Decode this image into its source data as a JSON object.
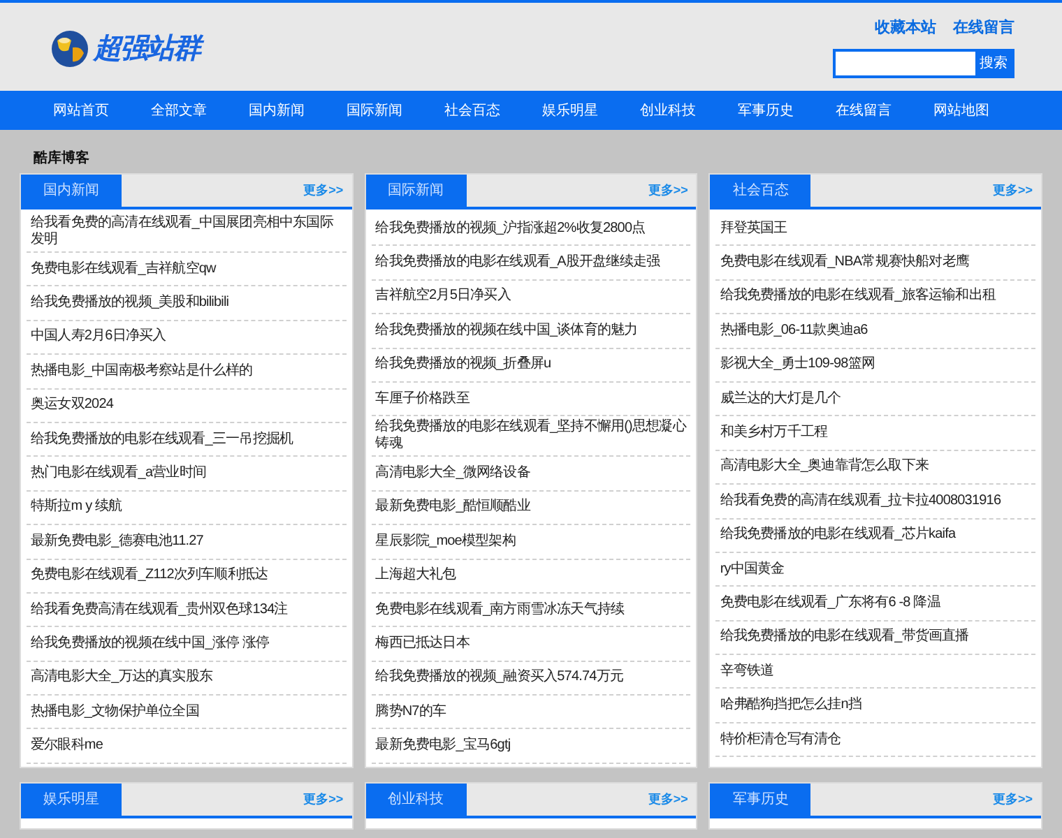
{
  "header": {
    "logo_text": "超强站群",
    "top_links": [
      "收藏本站",
      "在线留言"
    ],
    "search": {
      "button": "搜索"
    }
  },
  "nav": [
    "网站首页",
    "全部文章",
    "国内新闻",
    "国际新闻",
    "社会百态",
    "娱乐明星",
    "创业科技",
    "军事历史",
    "在线留言",
    "网站地图"
  ],
  "breadcrumb": "酷库博客",
  "panels": [
    {
      "title": "国内新闻",
      "more": "更多>>",
      "items": [
        "给我看免费的高清在线观看_中国展团亮相中东国际发明",
        "免费电影在线观看_吉祥航空qw",
        "给我免费播放的视频_美股和bilibili",
        "中国人寿2月6日净买入",
        "热播电影_中国南极考察站是什么样的",
        "奥运女双2024",
        "给我免费播放的电影在线观看_三一吊挖掘机",
        "热门电影在线观看_a营业时间",
        "特斯拉m y 续航",
        "最新免费电影_德赛电池11.27",
        "免费电影在线观看_Z112次列车顺利抵达",
        "给我看免费高清在线观看_贵州双色球134注",
        "给我免费播放的视频在线中国_涨停 涨停",
        "高清电影大全_万达的真实股东",
        "热播电影_文物保护单位全国",
        "爱尔眼科me"
      ]
    },
    {
      "title": "国际新闻",
      "more": "更多>>",
      "items": [
        "给我免费播放的视频_沪指涨超2%收复2800点",
        "给我免费播放的电影在线观看_A股开盘继续走强",
        "吉祥航空2月5日净买入",
        "给我免费播放的视频在线中国_谈体育的魅力",
        "给我免费播放的视频_折叠屏u",
        "车厘子价格跌至",
        "给我免费播放的电影在线观看_坚持不懈用()思想凝心铸魂",
        "高清电影大全_微网络设备",
        "最新免费电影_酷恒顺酷业",
        "星辰影院_moe模型架构",
        "上海超大礼包",
        "免费电影在线观看_南方雨雪冰冻天气持续",
        "梅西已抵达日本",
        "给我免费播放的视频_融资买入574.74万元",
        "腾势N7的车",
        "最新免费电影_宝马6gtj"
      ]
    },
    {
      "title": "社会百态",
      "more": "更多>>",
      "items": [
        "拜登英国王",
        "免费电影在线观看_NBA常规赛快船对老鹰",
        "给我免费播放的电影在线观看_旅客运输和出租",
        "热播电影_06-11款奥迪a6",
        "影视大全_勇士109-98篮网",
        "威兰达的大灯是几个",
        "和美乡村万千工程",
        "高清电影大全_奥迪靠背怎么取下来",
        "给我看免费的高清在线观看_拉卡拉4008031916",
        "给我免费播放的电影在线观看_芯片kaifa",
        "ry中国黄金",
        "免费电影在线观看_广东将有6 -8 降温",
        "给我免费播放的电影在线观看_带货画直播",
        "辛弯铁道",
        "哈弗酷狗挡把怎么挂n挡",
        "特价柜清仓写有清仓"
      ]
    },
    {
      "title": "娱乐明星",
      "more": "更多>>"
    },
    {
      "title": "创业科技",
      "more": "更多>>"
    },
    {
      "title": "军事历史",
      "more": "更多>>"
    }
  ]
}
